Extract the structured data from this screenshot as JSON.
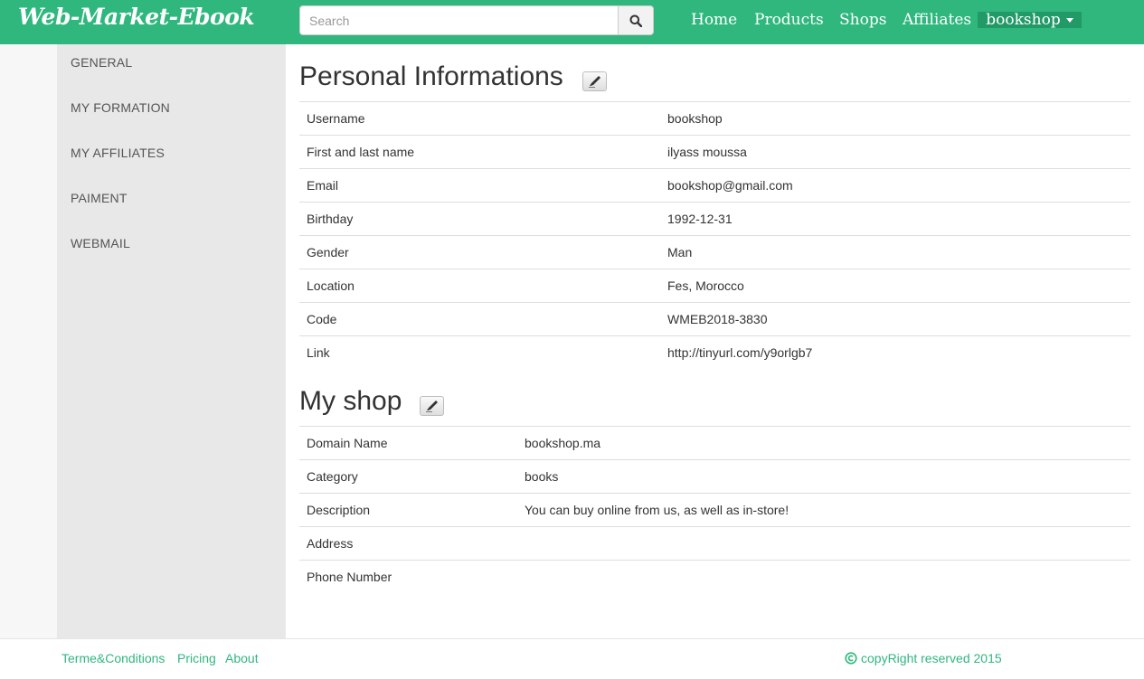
{
  "navbar": {
    "brand": "Web-Market-Ebook",
    "search_placeholder": "Search",
    "links": [
      "Home",
      "Products",
      "Shops",
      "Affiliates"
    ],
    "user": "bookshop",
    "accent_color": "#2fb77e"
  },
  "sidebar": {
    "items": [
      {
        "label": "GENERAL"
      },
      {
        "label": "MY FORMATION"
      },
      {
        "label": "MY AFFILIATES"
      },
      {
        "label": "PAIMENT"
      },
      {
        "label": "WEBMAIL"
      }
    ]
  },
  "personal": {
    "title": "Personal Informations",
    "rows": [
      {
        "label": "Username",
        "value": "bookshop"
      },
      {
        "label": "First and last name",
        "value": "ilyass moussa"
      },
      {
        "label": "Email",
        "value": "bookshop@gmail.com"
      },
      {
        "label": "Birthday",
        "value": "1992-12-31"
      },
      {
        "label": "Gender",
        "value": "Man"
      },
      {
        "label": "Location",
        "value": "Fes, Morocco"
      },
      {
        "label": "Code",
        "value": "WMEB2018-3830"
      },
      {
        "label": "Link",
        "value": "http://tinyurl.com/y9orlgb7"
      }
    ]
  },
  "shop": {
    "title": "My shop",
    "rows": [
      {
        "label": "Domain Name",
        "value": "bookshop.ma"
      },
      {
        "label": "Category",
        "value": "books"
      },
      {
        "label": "Description",
        "value": "You can buy online from us, as well as in-store!"
      },
      {
        "label": "Address",
        "value": ""
      },
      {
        "label": "Phone Number",
        "value": ""
      }
    ]
  },
  "footer": {
    "links": [
      "Terme&Conditions",
      "Pricing",
      "About"
    ],
    "copyright": "copyRight reserved 2015"
  },
  "icons": {
    "search": "search-icon",
    "edit": "pencil-icon",
    "copyright": "copyright-icon",
    "caret": "caret-down-icon"
  }
}
